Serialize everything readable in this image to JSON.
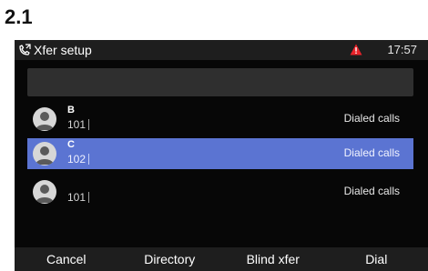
{
  "section_label": "2.1",
  "titlebar": {
    "icon": "call-transfer-icon",
    "title": "Xfer setup",
    "warning_icon": "warning-triangle-icon",
    "time": "17:57"
  },
  "search": {
    "value": ""
  },
  "contacts": [
    {
      "name": "B",
      "number": "101",
      "call_type": "Dialed calls",
      "selected": false
    },
    {
      "name": "C",
      "number": "102",
      "call_type": "Dialed calls",
      "selected": true
    },
    {
      "name": "",
      "number": "101",
      "call_type": "Dialed calls",
      "selected": false
    }
  ],
  "softkeys": [
    "Cancel",
    "Directory",
    "Blind xfer",
    "Dial"
  ],
  "colors": {
    "background": "#070707",
    "bar": "#1e1e1e",
    "selection": "#5b74d2",
    "warning": "#e8232a"
  }
}
